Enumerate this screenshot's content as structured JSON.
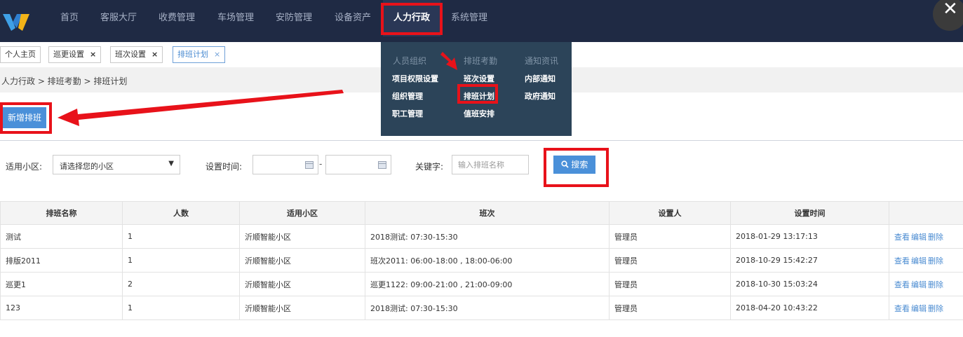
{
  "nav": {
    "items": [
      "首页",
      "客服大厅",
      "收费管理",
      "车场管理",
      "安防管理",
      "设备资产",
      "人力行政",
      "系统管理"
    ],
    "active": "人力行政"
  },
  "tabs": [
    {
      "label": "个人主页",
      "closable": false
    },
    {
      "label": "巡更设置",
      "closable": true
    },
    {
      "label": "班次设置",
      "closable": true
    },
    {
      "label": "排班计划",
      "closable": true,
      "active": true
    }
  ],
  "tab_close_glyph": "×",
  "breadcrumb": "人力行政 > 排班考勤 > 排班计划",
  "add_button": "新增排班",
  "filters": {
    "community_label": "适用小区:",
    "community_value": "请选择您的小区",
    "time_label": "设置时间:",
    "range_separator": "-",
    "keyword_label": "关键字:",
    "keyword_placeholder": "输入排班名称",
    "search_button": "搜索"
  },
  "dropdown": {
    "columns": [
      {
        "heading": "人员组织",
        "items": [
          "项目权限设置",
          "组织管理",
          "职工管理"
        ]
      },
      {
        "heading": "排班考勤",
        "items": [
          "班次设置",
          "排班计划",
          "值班安排"
        ]
      },
      {
        "heading": "通知资讯",
        "items": [
          "内部通知",
          "政府通知"
        ]
      }
    ]
  },
  "table": {
    "headers": [
      "排班名称",
      "人数",
      "适用小区",
      "班次",
      "设置人",
      "设置时间",
      ""
    ],
    "rows": [
      {
        "name": "测试",
        "count": "1",
        "community": "沂顺智能小区",
        "shift": "2018测试: 07:30-15:30",
        "setter": "管理员",
        "time": "2018-01-29 13:17:13"
      },
      {
        "name": "排版2011",
        "count": "1",
        "community": "沂顺智能小区",
        "shift": "班次2011: 06:00-18:00 , 18:00-06:00",
        "setter": "管理员",
        "time": "2018-10-29 15:42:27"
      },
      {
        "name": "巡更1",
        "count": "2",
        "community": "沂顺智能小区",
        "shift": "巡更1122: 09:00-21:00 , 21:00-09:00",
        "setter": "管理员",
        "time": "2018-10-30 15:03:24"
      },
      {
        "name": "123",
        "count": "1",
        "community": "沂顺智能小区",
        "shift": "2018测试: 07:30-15:30",
        "setter": "管理员",
        "time": "2018-04-20 10:43:22"
      }
    ],
    "actions": [
      "查看",
      "编辑",
      "删除"
    ]
  },
  "colors": {
    "nav_bg": "#1f2a44",
    "menu_bg": "#2c4459",
    "accent": "#4a90d9",
    "highlight": "#e8121a"
  }
}
